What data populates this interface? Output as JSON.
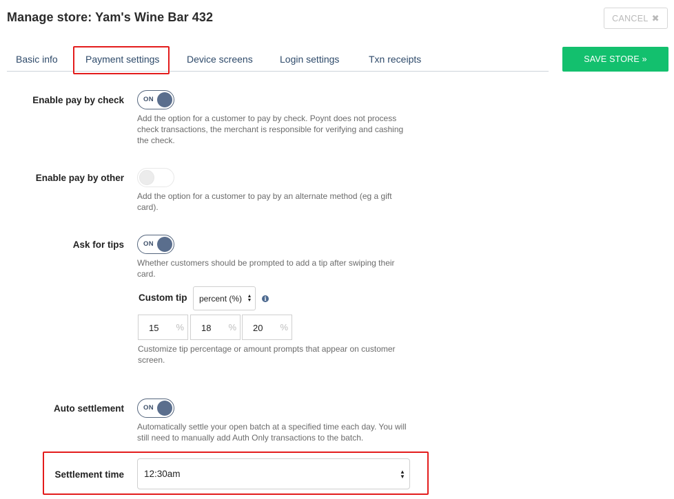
{
  "header": {
    "title": "Manage store: Yam's Wine Bar 432",
    "cancel_label": "CANCEL",
    "cancel_icon": "close-icon",
    "save_label": "SAVE STORE »"
  },
  "tabs": [
    {
      "label": "Basic info"
    },
    {
      "label": "Payment settings",
      "active": true
    },
    {
      "label": "Device screens"
    },
    {
      "label": "Login settings"
    },
    {
      "label": "Txn receipts"
    }
  ],
  "settings": {
    "pay_by_check": {
      "label": "Enable pay by check",
      "toggle": "ON",
      "help": "Add the option for a customer to pay by check. Poynt does not process check transactions, the merchant is responsible for verifying and cashing the check."
    },
    "pay_by_other": {
      "label": "Enable pay by other",
      "help": "Add the option for a customer to pay by an alternate method (eg a gift card)."
    },
    "tips": {
      "label": "Ask for tips",
      "toggle": "ON",
      "help": "Whether customers should be prompted to add a tip after swiping their card.",
      "custom_tip_label": "Custom tip",
      "custom_tip_mode": "percent (%)",
      "tip_values": [
        "15",
        "18",
        "20"
      ],
      "tip_unit": "%",
      "tip_help": "Customize tip percentage or amount prompts that appear on customer screen."
    },
    "auto_settlement": {
      "label": "Auto settlement",
      "toggle": "ON",
      "help": "Automatically settle your open batch at a specified time each day. You will still need to manually add Auth Only transactions to the batch."
    },
    "settlement_time": {
      "label": "Settlement time",
      "value": "12:30am"
    }
  },
  "colors": {
    "accent_green": "#13c06e",
    "toggle_on": "#5a6e8d",
    "highlight_red": "#e31b1b",
    "tab_text": "#2e4a6a"
  }
}
